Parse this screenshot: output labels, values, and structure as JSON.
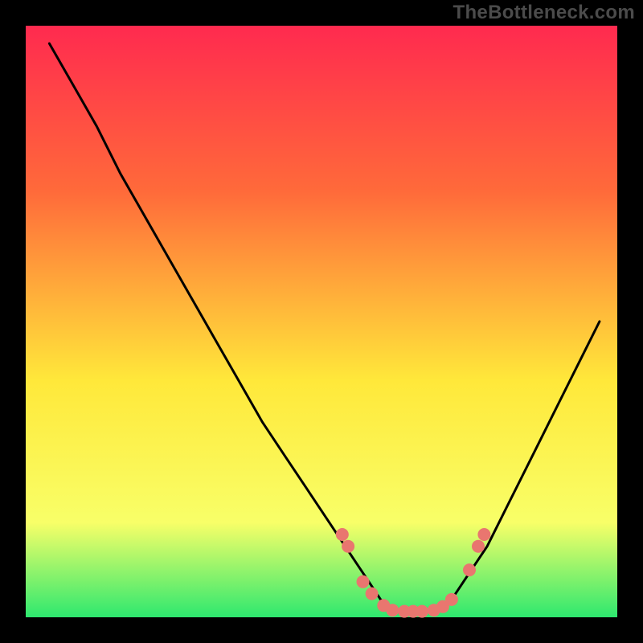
{
  "watermark": "TheBottleneck.com",
  "colors": {
    "background": "#000000",
    "gradient_top": "#ff2a4f",
    "gradient_mid_upper": "#ff6a3a",
    "gradient_mid": "#ffe83a",
    "gradient_lower": "#f8ff68",
    "gradient_bottom": "#2ee86f",
    "curve": "#000000",
    "dots": "#e9766f",
    "watermark": "#4b4b4b"
  },
  "chart_data": {
    "type": "line",
    "title": "",
    "xlabel": "",
    "ylabel": "",
    "xlim": [
      0,
      100
    ],
    "ylim": [
      0,
      100
    ],
    "series": [
      {
        "name": "bottleneck-curve",
        "x": [
          4,
          8,
          12,
          16,
          20,
          24,
          28,
          32,
          36,
          40,
          44,
          48,
          52,
          56,
          58,
          60,
          62,
          64,
          66,
          68,
          70,
          72,
          74,
          78,
          82,
          86,
          90,
          94,
          97
        ],
        "y": [
          97,
          90,
          83,
          75,
          68,
          61,
          54,
          47,
          40,
          33,
          27,
          21,
          15,
          9,
          6,
          3,
          1.5,
          1,
          1,
          1,
          1.5,
          3,
          6,
          12,
          20,
          28,
          36,
          44,
          50
        ]
      }
    ],
    "highlight_points": {
      "name": "sweet-spot-dots",
      "x": [
        53.5,
        54.5,
        57,
        58.5,
        60.5,
        62,
        64,
        65.5,
        67,
        69,
        70.5,
        72,
        75,
        76.5,
        77.5
      ],
      "y": [
        14,
        12,
        6,
        4,
        2,
        1.2,
        1,
        1,
        1,
        1.2,
        1.8,
        3,
        8,
        12,
        14
      ]
    }
  }
}
